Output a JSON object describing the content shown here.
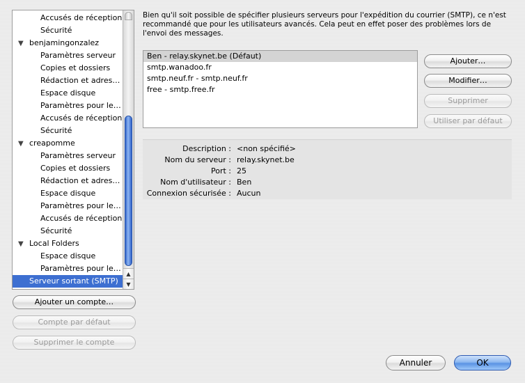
{
  "tree": {
    "items": [
      {
        "label": "Accusés de réception",
        "kind": "child"
      },
      {
        "label": "Sécurité",
        "kind": "child"
      },
      {
        "label": "benjamingonzalez",
        "kind": "account"
      },
      {
        "label": "Paramètres serveur",
        "kind": "child"
      },
      {
        "label": "Copies et dossiers",
        "kind": "child"
      },
      {
        "label": "Rédaction et adress…",
        "kind": "child"
      },
      {
        "label": "Espace disque",
        "kind": "child"
      },
      {
        "label": "Paramètres pour le…",
        "kind": "child"
      },
      {
        "label": "Accusés de réception",
        "kind": "child"
      },
      {
        "label": "Sécurité",
        "kind": "child"
      },
      {
        "label": "creapomme",
        "kind": "account"
      },
      {
        "label": "Paramètres serveur",
        "kind": "child"
      },
      {
        "label": "Copies et dossiers",
        "kind": "child"
      },
      {
        "label": "Rédaction et adress…",
        "kind": "child"
      },
      {
        "label": "Espace disque",
        "kind": "child"
      },
      {
        "label": "Paramètres pour le…",
        "kind": "child"
      },
      {
        "label": "Accusés de réception",
        "kind": "child"
      },
      {
        "label": "Sécurité",
        "kind": "child"
      },
      {
        "label": "Local Folders",
        "kind": "account"
      },
      {
        "label": "Espace disque",
        "kind": "child"
      },
      {
        "label": "Paramètres pour le…",
        "kind": "child"
      },
      {
        "label": "Serveur sortant (SMTP)",
        "kind": "selected"
      }
    ],
    "expand_glyph": "▼"
  },
  "account_buttons": {
    "add": "Ajouter un compte…",
    "default": "Compte par défaut",
    "delete": "Supprimer le compte"
  },
  "smtp": {
    "description": "Bien qu'il soit possible de spécifier plusieurs serveurs pour l'expédition du courrier (SMTP), ce n'est recommandé que pour les utilisateurs avancés. Cela peut en effet poser des problèmes lors de l'envoi des messages.",
    "servers": [
      "Ben - relay.skynet.be (Défaut)",
      "smtp.wanadoo.fr",
      "smtp.neuf.fr - smtp.neuf.fr",
      "free - smtp.free.fr"
    ],
    "buttons": {
      "add": "Ajouter…",
      "edit": "Modifier…",
      "delete": "Supprimer",
      "set_default": "Utiliser par défaut"
    },
    "details": {
      "description_label": "Description :",
      "description_value": "<non spécifié>",
      "server_label": "Nom du serveur :",
      "server_value": "relay.skynet.be",
      "port_label": "Port :",
      "port_value": "25",
      "user_label": "Nom d'utilisateur :",
      "user_value": "Ben",
      "secure_label": "Connexion sécurisée :",
      "secure_value": "Aucun"
    }
  },
  "dialog": {
    "cancel": "Annuler",
    "ok": "OK"
  },
  "colors": {
    "selection": "#3d6fd1",
    "default_button": "#5a93e4"
  }
}
